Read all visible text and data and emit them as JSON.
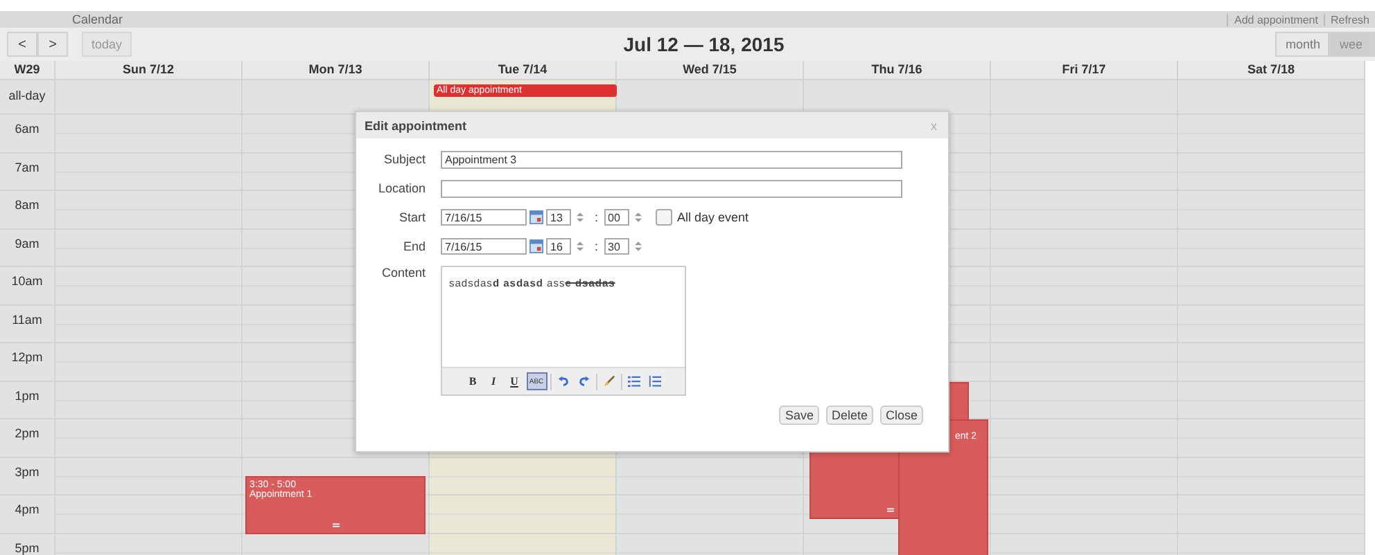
{
  "app": {
    "title": "Calendar",
    "links": [
      "Add appointment",
      "Refresh"
    ]
  },
  "toolbar": {
    "nav": [
      "<",
      ">"
    ],
    "today": {
      "label": "today",
      "disabled": true
    },
    "range_title": "Jul 12 — 18, 2015",
    "views": [
      {
        "label": "month",
        "selected": false
      },
      {
        "label": "wee",
        "selected": true
      }
    ]
  },
  "grid": {
    "week_label": "W29",
    "all_day_label": "all-day",
    "days": [
      {
        "label": "Sun 7/12",
        "today": false
      },
      {
        "label": "Mon 7/13",
        "today": false,
        "events": [
          {
            "kind": "appointment",
            "time": "3:30 - 5:00",
            "title": "Appointment 1"
          }
        ]
      },
      {
        "label": "Tue 7/14",
        "today": true,
        "all_day_events": [
          {
            "title": "All day appointment"
          }
        ]
      },
      {
        "label": "Wed 7/15",
        "today": false
      },
      {
        "label": "Thu 7/16",
        "today": false,
        "events": [
          {
            "kind": "appointment"
          },
          {
            "kind": "appointment",
            "title": "ent 2"
          }
        ]
      },
      {
        "label": "Fri 7/17",
        "today": false
      },
      {
        "label": "Sat 7/18",
        "today": false
      }
    ],
    "hours": [
      "6am",
      "7am",
      "8am",
      "9am",
      "10am",
      "11am",
      "12pm",
      "1pm",
      "2pm",
      "3pm",
      "4pm",
      "5pm"
    ]
  },
  "dialog": {
    "title": "Edit appointment",
    "close": "x",
    "subject": {
      "label": "Subject",
      "value": "Appointment 3"
    },
    "location": {
      "label": "Location"
    },
    "start": {
      "label": "Start",
      "date": "7/16/15",
      "hour": "13",
      "minute": "00",
      "separator": ":"
    },
    "all_day": {
      "label": "All day event",
      "checked": false
    },
    "end": {
      "label": "End",
      "date": "7/16/15",
      "hour": "16",
      "minute": "30",
      "separator": ":"
    },
    "content": {
      "label": "Content",
      "segments": [
        {
          "text": "sadsdas",
          "kind": "plain"
        },
        {
          "text": "d asdasd",
          "kind": "bold"
        },
        {
          "text": " ass",
          "kind": "plain"
        },
        {
          "text": "e dsadas",
          "kind": "struck"
        }
      ]
    },
    "tool_groups": [
      [
        {
          "kind": "bold",
          "label": "B",
          "active": false
        },
        {
          "kind": "italic",
          "label": "I",
          "active": false
        },
        {
          "kind": "underline",
          "label": "U",
          "active": false
        },
        {
          "kind": "strike",
          "label": "ABC",
          "active": true
        }
      ],
      [
        {
          "kind": "undo",
          "active": false
        },
        {
          "kind": "redo",
          "active": false
        }
      ],
      [
        {
          "kind": "clean",
          "active": false
        }
      ],
      [
        {
          "kind": "bullets",
          "active": false
        },
        {
          "kind": "numbers",
          "active": false
        }
      ]
    ],
    "buttons": [
      "Save",
      "Delete",
      "Close"
    ]
  }
}
